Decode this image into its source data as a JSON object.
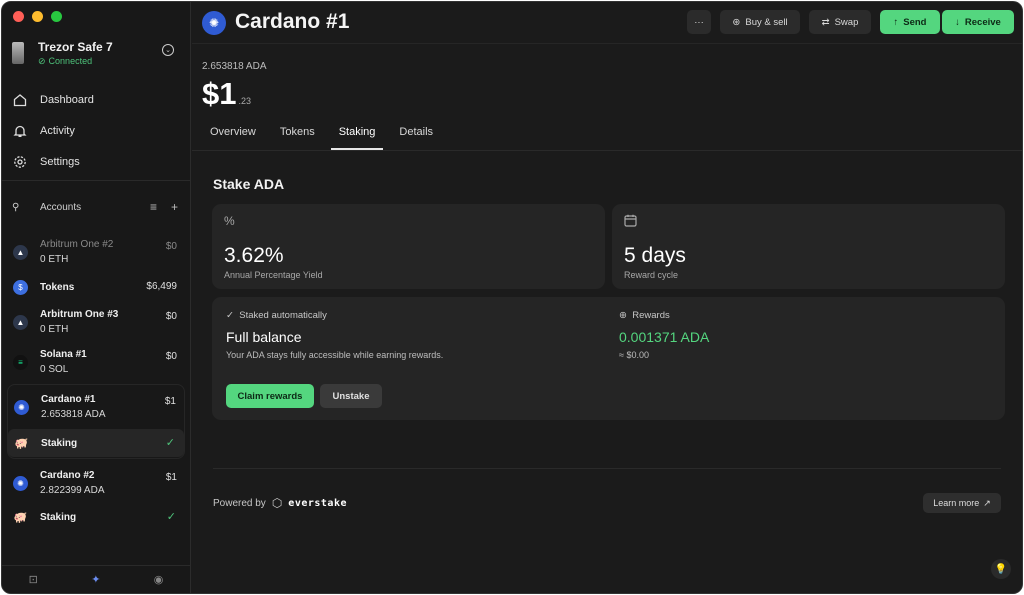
{
  "device": {
    "name": "Trezor Safe 7",
    "status": "Connected"
  },
  "nav": [
    {
      "label": "Dashboard",
      "icon": "home-icon"
    },
    {
      "label": "Activity",
      "icon": "bell-icon"
    },
    {
      "label": "Settings",
      "icon": "gear-icon"
    }
  ],
  "accounts_header": {
    "label": "Accounts"
  },
  "accounts": [
    {
      "name": "Arbitrum One #2",
      "amount": "0 ETH",
      "value": "$0"
    },
    {
      "name": "Tokens",
      "value": "$6,499"
    },
    {
      "name": "Arbitrum One #3",
      "amount": "0 ETH",
      "value": "$0"
    },
    {
      "name": "Solana #1",
      "amount": "0 SOL",
      "value": "$0"
    },
    {
      "name": "Cardano #1",
      "amount": "2.653818 ADA",
      "value": "$1",
      "sub_label": "Staking"
    },
    {
      "name": "Cardano #2",
      "amount": "2.822399 ADA",
      "value": "$1",
      "sub_label": "Staking"
    }
  ],
  "header": {
    "title": "Cardano #1",
    "more_label": "···",
    "buy_sell_label": "Buy & sell",
    "swap_label": "Swap",
    "send_label": "Send",
    "receive_label": "Receive"
  },
  "balance": {
    "crypto": "2.653818 ADA",
    "fiat_main": "$1",
    "fiat_cents": ".23"
  },
  "tabs": [
    "Overview",
    "Tokens",
    "Staking",
    "Details"
  ],
  "staking": {
    "title": "Stake ADA",
    "apy_value": "3.62%",
    "apy_label": "Annual Percentage Yield",
    "cycle_value": "5 days",
    "cycle_label": "Reward cycle",
    "auto_label": "Staked automatically",
    "balance_title": "Full balance",
    "balance_desc": "Your ADA stays fully accessible while earning rewards.",
    "rewards_label": "Rewards",
    "rewards_value": "0.001371 ADA",
    "rewards_fiat": "≈ $0.00",
    "claim_label": "Claim rewards",
    "unstake_label": "Unstake"
  },
  "footer": {
    "powered_by": "Powered by",
    "provider": "everstake",
    "learn_more": "Learn more"
  },
  "colors": {
    "accent": "#54d67f",
    "background": "#1b1b1b",
    "card": "#252525"
  }
}
